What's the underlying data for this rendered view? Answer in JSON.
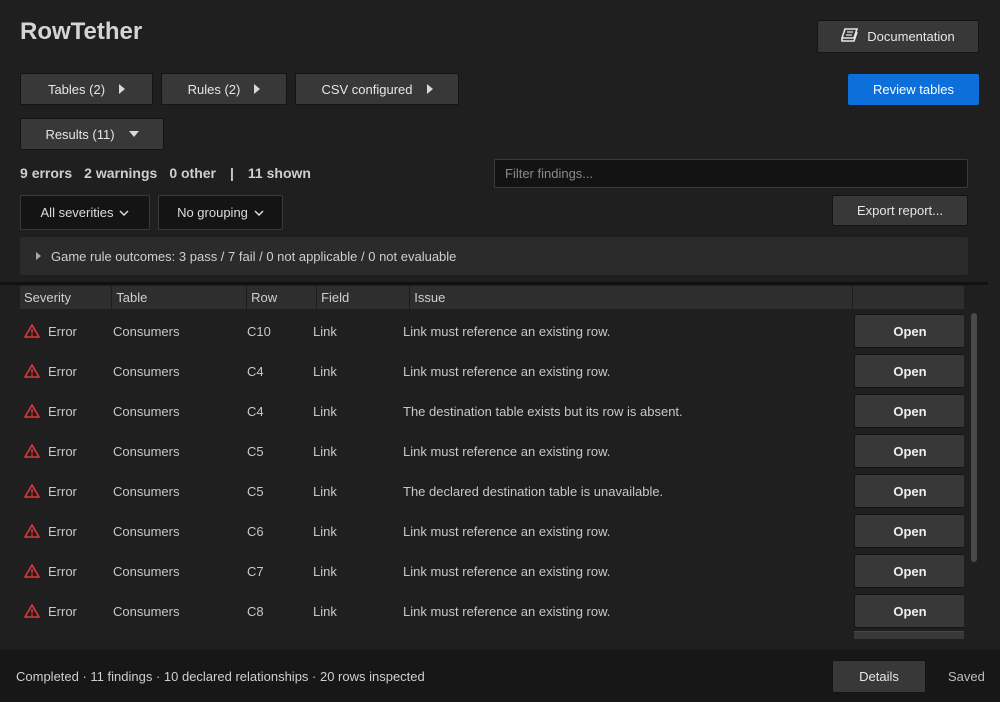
{
  "app": {
    "title": "RowTether"
  },
  "header": {
    "documentation_label": "Documentation"
  },
  "toolbar": {
    "tables_label": "Tables (2)",
    "rules_label": "Rules (2)",
    "csv_label": "CSV configured",
    "results_label": "Results (11)",
    "review_label": "Review tables"
  },
  "summary": {
    "errors_count": "9",
    "errors_label": "errors",
    "warnings_count": "2",
    "warnings_label": "warnings",
    "other_count": "0",
    "other_label": "other",
    "separator": "|",
    "shown_count": "11",
    "shown_label": "shown"
  },
  "filter": {
    "placeholder": "Filter findings..."
  },
  "controls": {
    "severity_filter": "All severities",
    "grouping": "No grouping",
    "export_label": "Export report..."
  },
  "outcomes": {
    "text": "Game rule outcomes: 3 pass / 7 fail / 0 not applicable / 0 not evaluable"
  },
  "table": {
    "columns": [
      "Severity",
      "Table",
      "Row",
      "Field",
      "Issue"
    ],
    "open_label": "Open",
    "rows": [
      {
        "severity": "Error",
        "table": "Consumers",
        "row": "C10",
        "field": "Link",
        "issue": "Link must reference an existing row."
      },
      {
        "severity": "Error",
        "table": "Consumers",
        "row": "C4",
        "field": "Link",
        "issue": "Link must reference an existing row."
      },
      {
        "severity": "Error",
        "table": "Consumers",
        "row": "C4",
        "field": "Link",
        "issue": "The destination table exists but its row is absent."
      },
      {
        "severity": "Error",
        "table": "Consumers",
        "row": "C5",
        "field": "Link",
        "issue": "Link must reference an existing row."
      },
      {
        "severity": "Error",
        "table": "Consumers",
        "row": "C5",
        "field": "Link",
        "issue": "The declared destination table is unavailable."
      },
      {
        "severity": "Error",
        "table": "Consumers",
        "row": "C6",
        "field": "Link",
        "issue": "Link must reference an existing row."
      },
      {
        "severity": "Error",
        "table": "Consumers",
        "row": "C7",
        "field": "Link",
        "issue": "Link must reference an existing row."
      },
      {
        "severity": "Error",
        "table": "Consumers",
        "row": "C8",
        "field": "Link",
        "issue": "Link must reference an existing row."
      }
    ]
  },
  "status": {
    "text": "Completed · 11 findings · 10 declared relationships · 20 rows inspected",
    "details_label": "Details",
    "saved_label": "Saved"
  },
  "colors": {
    "accent": "#0d6fd9",
    "error": "#e0393e",
    "background": "#1f1f1f"
  },
  "icons": {
    "documentation": "book-icon",
    "error": "warning-triangle-icon"
  }
}
